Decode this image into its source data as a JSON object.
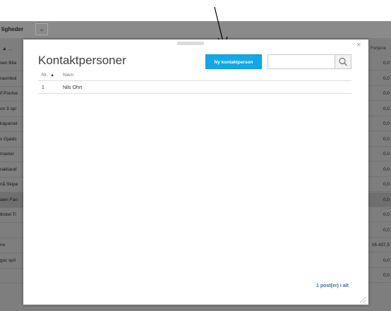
{
  "background": {
    "tab_label": "ligheder",
    "header_left": "▲ ...",
    "header_right": "Fortjene",
    "rows": [
      {
        "left": "sen Bila",
        "right": "0,0"
      },
      {
        "left": "raumbol",
        "right": "0,0"
      },
      {
        "left": "if Poulse",
        "right": "0,0"
      },
      {
        "left": "on 3 sp/",
        "right": "0,0"
      },
      {
        "left": "kaparsel",
        "right": "0,0"
      },
      {
        "left": "s Gjalds",
        "right": "0,0"
      },
      {
        "left": "master",
        "right": "0,0"
      },
      {
        "left": "raktiaraf",
        "right": "0,0"
      },
      {
        "left": "nå Skipa",
        "right": "0,0"
      },
      {
        "left": "awn Fari",
        "right": "0,0"
      },
      {
        "left": "thotel Ti",
        "right": "0,0"
      },
      {
        "left": "",
        "right": "0,0"
      },
      {
        "left": "no",
        "right": "16.437,5"
      },
      {
        "left": "gsc sp/l",
        "right": "0,0"
      },
      {
        "left": "",
        "right": "0,0"
      }
    ]
  },
  "modal": {
    "title": "Kontaktpersoner",
    "new_button": "Ny kontaktperson",
    "search_value": "",
    "columns": {
      "nr": "Nr.",
      "name": "Navn"
    },
    "rows": [
      {
        "nr": "1",
        "name": "Nils Ohrt"
      }
    ],
    "footer": "1 post(er) i alt",
    "close_label": "×"
  },
  "colors": {
    "accent": "#13a7e8",
    "overlay": "#7e7e7e"
  }
}
